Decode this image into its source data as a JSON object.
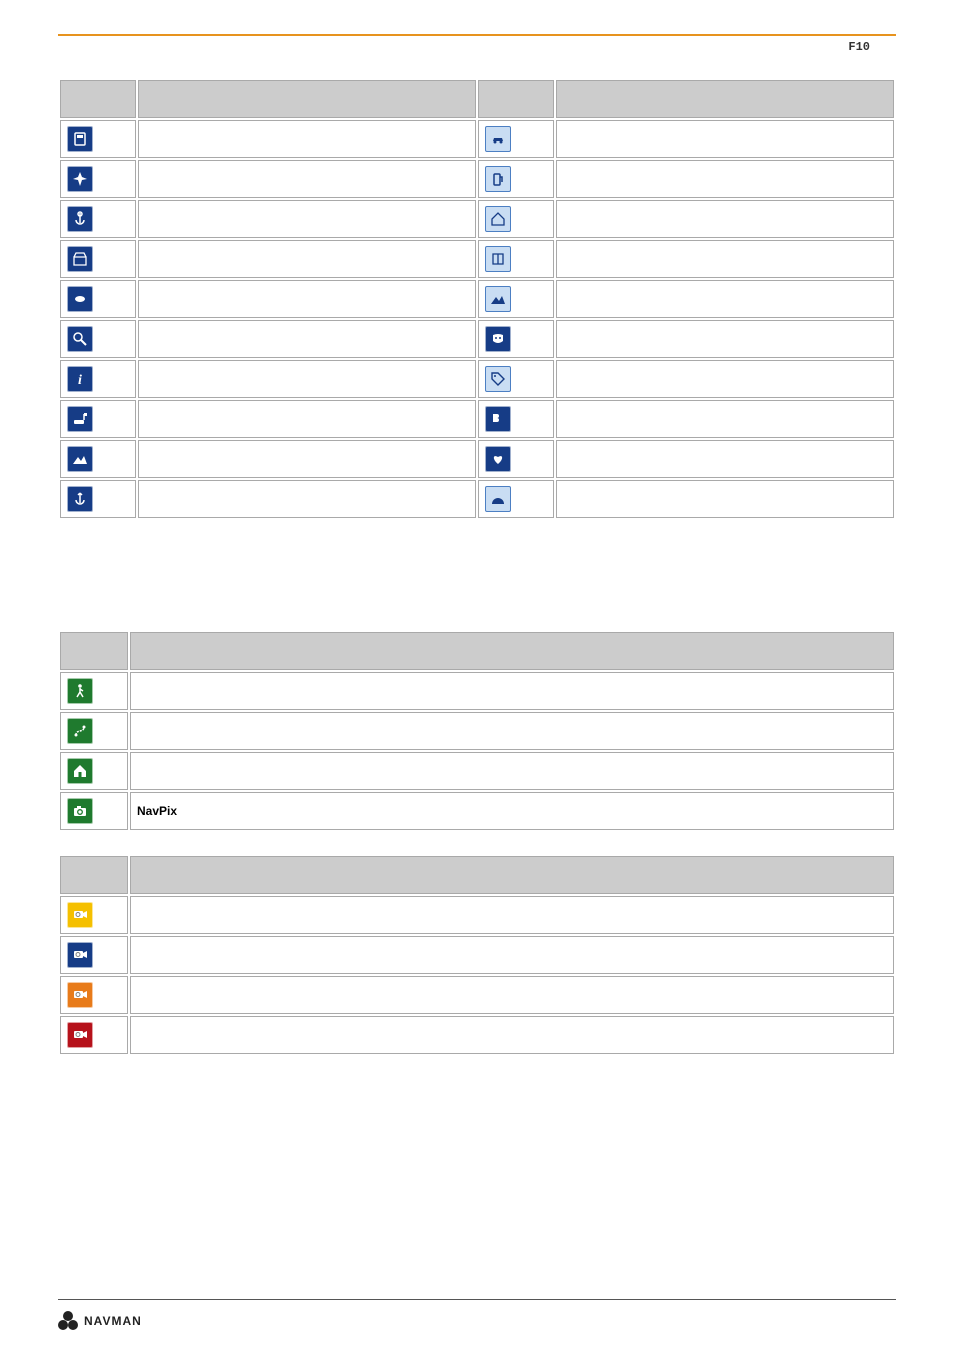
{
  "header_label": "F10",
  "table1": {
    "headers": [
      "",
      "",
      "",
      ""
    ],
    "rows": [
      {
        "l": {
          "name": "atm-icon",
          "bg": "blue-dark",
          "glyph": "atm"
        },
        "r": {
          "name": "car-icon",
          "bg": "blue-light",
          "glyph": "car"
        }
      },
      {
        "l": {
          "name": "airport-icon",
          "bg": "blue-dark",
          "glyph": "plane"
        },
        "r": {
          "name": "fuel-icon",
          "bg": "blue-light",
          "glyph": "fuel"
        }
      },
      {
        "l": {
          "name": "anchor-icon",
          "bg": "blue-dark",
          "glyph": "anchor"
        },
        "r": {
          "name": "house-abc-icon",
          "bg": "blue-light",
          "glyph": "house"
        }
      },
      {
        "l": {
          "name": "shop-icon",
          "bg": "blue-dark",
          "glyph": "shop"
        },
        "r": {
          "name": "book-icon",
          "bg": "blue-light",
          "glyph": "book"
        }
      },
      {
        "l": {
          "name": "disc-icon",
          "bg": "blue-dark",
          "glyph": "disc"
        },
        "r": {
          "name": "landscape-icon",
          "bg": "blue-light",
          "glyph": "landscape"
        }
      },
      {
        "l": {
          "name": "zoom-icon",
          "bg": "blue-dark",
          "glyph": "zoom"
        },
        "r": {
          "name": "theatre-icon",
          "bg": "blue-dark",
          "glyph": "theatre"
        }
      },
      {
        "l": {
          "name": "info-icon",
          "bg": "blue-dark",
          "glyph": "info"
        },
        "r": {
          "name": "tag-icon",
          "bg": "blue-light",
          "glyph": "tag"
        }
      },
      {
        "l": {
          "name": "car-flag-icon",
          "bg": "blue-dark",
          "glyph": "carflag"
        },
        "r": {
          "name": "puzzle-icon",
          "bg": "blue-dark",
          "glyph": "puzzle"
        }
      },
      {
        "l": {
          "name": "hill-icon",
          "bg": "blue-dark",
          "glyph": "landscape"
        },
        "r": {
          "name": "favorite-icon",
          "bg": "blue-dark",
          "glyph": "heart"
        }
      },
      {
        "l": {
          "name": "port-icon",
          "bg": "blue-dark",
          "glyph": "anchor2"
        },
        "r": {
          "name": "cave-icon",
          "bg": "blue-light",
          "glyph": "cave"
        }
      }
    ]
  },
  "table2": {
    "headers": [
      "",
      ""
    ],
    "rows": [
      {
        "icon": {
          "name": "walk-icon",
          "bg": "green-dark",
          "glyph": "walk"
        },
        "label": ""
      },
      {
        "icon": {
          "name": "route-icon",
          "bg": "green-dark",
          "glyph": "route"
        },
        "label": ""
      },
      {
        "icon": {
          "name": "home-icon",
          "bg": "green-dark",
          "glyph": "home"
        },
        "label": ""
      },
      {
        "icon": {
          "name": "navpix-icon",
          "bg": "green-dark",
          "glyph": "camera"
        },
        "label": "NavPix"
      }
    ]
  },
  "table3": {
    "headers": [
      "",
      ""
    ],
    "rows": [
      {
        "icon": {
          "name": "camera-yellow-icon",
          "bg": "yellow",
          "glyph": "speedcam"
        },
        "label": ""
      },
      {
        "icon": {
          "name": "camera-blue-icon",
          "bg": "blue-dark",
          "glyph": "speedcam"
        },
        "label": ""
      },
      {
        "icon": {
          "name": "camera-orange-icon",
          "bg": "orange",
          "glyph": "speedcam"
        },
        "label": ""
      },
      {
        "icon": {
          "name": "camera-red-icon",
          "bg": "red",
          "glyph": "speedcam"
        },
        "label": ""
      }
    ]
  },
  "footer_brand": "NAVMAN"
}
